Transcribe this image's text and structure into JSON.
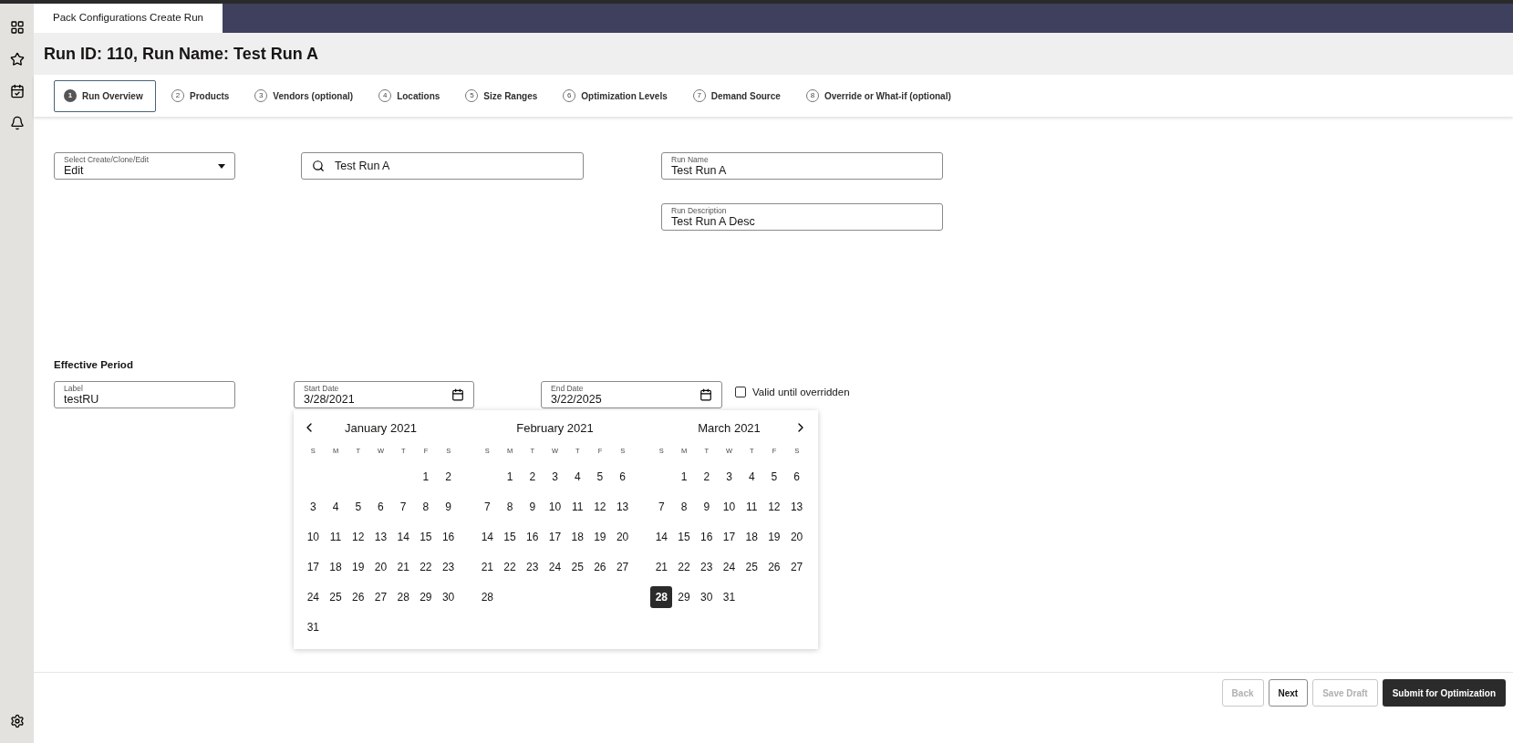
{
  "app_tab": {
    "label": "Pack Configurations Create Run"
  },
  "page_title": "Run ID: 110, Run Name: Test Run A",
  "steps": [
    {
      "number": "1",
      "label": "Run Overview",
      "selected": true
    },
    {
      "number": "2",
      "label": "Products",
      "selected": false
    },
    {
      "number": "3",
      "label": "Vendors (optional)",
      "selected": false
    },
    {
      "number": "4",
      "label": "Locations",
      "selected": false
    },
    {
      "number": "5",
      "label": "Size Ranges",
      "selected": false
    },
    {
      "number": "6",
      "label": "Optimization Levels",
      "selected": false
    },
    {
      "number": "7",
      "label": "Demand Source",
      "selected": false
    },
    {
      "number": "8",
      "label": "Override or What-if (optional)",
      "selected": false
    }
  ],
  "mode_select": {
    "label": "Select Create/Clone/Edit",
    "value": "Edit"
  },
  "search": {
    "value": "Test Run A"
  },
  "run_name": {
    "label": "Run Name",
    "value": "Test Run A"
  },
  "run_description": {
    "label": "Run Description",
    "value": "Test Run A Desc"
  },
  "effective_period": {
    "heading": "Effective Period",
    "label_field": {
      "label": "Label",
      "value": "testRU"
    },
    "start_date": {
      "label": "Start Date",
      "value": "3/28/2021"
    },
    "end_date": {
      "label": "End Date",
      "value": "3/22/2025"
    },
    "valid_until_overridden": {
      "label": "Valid until overridden",
      "checked": false
    }
  },
  "calendar": {
    "months": [
      {
        "title": "January 2021",
        "weekdays": [
          "S",
          "M",
          "T",
          "W",
          "T",
          "F",
          "S"
        ],
        "weeks": [
          {
            "kind": "leading",
            "days": [
              {
                "d": "1",
                "selected": false
              },
              {
                "d": "2",
                "selected": false
              }
            ]
          },
          {
            "kind": "full",
            "days": [
              {
                "d": "3",
                "selected": false
              },
              {
                "d": "4",
                "selected": false
              },
              {
                "d": "5",
                "selected": false
              },
              {
                "d": "6",
                "selected": false
              },
              {
                "d": "7",
                "selected": false
              },
              {
                "d": "8",
                "selected": false
              },
              {
                "d": "9",
                "selected": false
              }
            ]
          },
          {
            "kind": "full",
            "days": [
              {
                "d": "10",
                "selected": false
              },
              {
                "d": "11",
                "selected": false
              },
              {
                "d": "12",
                "selected": false
              },
              {
                "d": "13",
                "selected": false
              },
              {
                "d": "14",
                "selected": false
              },
              {
                "d": "15",
                "selected": false
              },
              {
                "d": "16",
                "selected": false
              }
            ]
          },
          {
            "kind": "full",
            "days": [
              {
                "d": "17",
                "selected": false
              },
              {
                "d": "18",
                "selected": false
              },
              {
                "d": "19",
                "selected": false
              },
              {
                "d": "20",
                "selected": false
              },
              {
                "d": "21",
                "selected": false
              },
              {
                "d": "22",
                "selected": false
              },
              {
                "d": "23",
                "selected": false
              }
            ]
          },
          {
            "kind": "full",
            "days": [
              {
                "d": "24",
                "selected": false
              },
              {
                "d": "25",
                "selected": false
              },
              {
                "d": "26",
                "selected": false
              },
              {
                "d": "27",
                "selected": false
              },
              {
                "d": "28",
                "selected": false
              },
              {
                "d": "29",
                "selected": false
              },
              {
                "d": "30",
                "selected": false
              }
            ]
          },
          {
            "kind": "trailing",
            "days": [
              {
                "d": "31",
                "selected": false
              }
            ]
          }
        ]
      },
      {
        "title": "February 2021",
        "weekdays": [
          "S",
          "M",
          "T",
          "W",
          "T",
          "F",
          "S"
        ],
        "weeks": [
          {
            "kind": "leading",
            "days": [
              {
                "d": "1",
                "selected": false
              },
              {
                "d": "2",
                "selected": false
              },
              {
                "d": "3",
                "selected": false
              },
              {
                "d": "4",
                "selected": false
              },
              {
                "d": "5",
                "selected": false
              },
              {
                "d": "6",
                "selected": false
              }
            ]
          },
          {
            "kind": "full",
            "days": [
              {
                "d": "7",
                "selected": false
              },
              {
                "d": "8",
                "selected": false
              },
              {
                "d": "9",
                "selected": false
              },
              {
                "d": "10",
                "selected": false
              },
              {
                "d": "11",
                "selected": false
              },
              {
                "d": "12",
                "selected": false
              },
              {
                "d": "13",
                "selected": false
              }
            ]
          },
          {
            "kind": "full",
            "days": [
              {
                "d": "14",
                "selected": false
              },
              {
                "d": "15",
                "selected": false
              },
              {
                "d": "16",
                "selected": false
              },
              {
                "d": "17",
                "selected": false
              },
              {
                "d": "18",
                "selected": false
              },
              {
                "d": "19",
                "selected": false
              },
              {
                "d": "20",
                "selected": false
              }
            ]
          },
          {
            "kind": "full",
            "days": [
              {
                "d": "21",
                "selected": false
              },
              {
                "d": "22",
                "selected": false
              },
              {
                "d": "23",
                "selected": false
              },
              {
                "d": "24",
                "selected": false
              },
              {
                "d": "25",
                "selected": false
              },
              {
                "d": "26",
                "selected": false
              },
              {
                "d": "27",
                "selected": false
              }
            ]
          },
          {
            "kind": "trailing",
            "days": [
              {
                "d": "28",
                "selected": false
              }
            ]
          }
        ]
      },
      {
        "title": "March 2021",
        "weekdays": [
          "S",
          "M",
          "T",
          "W",
          "T",
          "F",
          "S"
        ],
        "weeks": [
          {
            "kind": "leading",
            "days": [
              {
                "d": "1",
                "selected": false
              },
              {
                "d": "2",
                "selected": false
              },
              {
                "d": "3",
                "selected": false
              },
              {
                "d": "4",
                "selected": false
              },
              {
                "d": "5",
                "selected": false
              },
              {
                "d": "6",
                "selected": false
              }
            ]
          },
          {
            "kind": "full",
            "days": [
              {
                "d": "7",
                "selected": false
              },
              {
                "d": "8",
                "selected": false
              },
              {
                "d": "9",
                "selected": false
              },
              {
                "d": "10",
                "selected": false
              },
              {
                "d": "11",
                "selected": false
              },
              {
                "d": "12",
                "selected": false
              },
              {
                "d": "13",
                "selected": false
              }
            ]
          },
          {
            "kind": "full",
            "days": [
              {
                "d": "14",
                "selected": false
              },
              {
                "d": "15",
                "selected": false
              },
              {
                "d": "16",
                "selected": false
              },
              {
                "d": "17",
                "selected": false
              },
              {
                "d": "18",
                "selected": false
              },
              {
                "d": "19",
                "selected": false
              },
              {
                "d": "20",
                "selected": false
              }
            ]
          },
          {
            "kind": "full",
            "days": [
              {
                "d": "21",
                "selected": false
              },
              {
                "d": "22",
                "selected": false
              },
              {
                "d": "23",
                "selected": false
              },
              {
                "d": "24",
                "selected": false
              },
              {
                "d": "25",
                "selected": false
              },
              {
                "d": "26",
                "selected": false
              },
              {
                "d": "27",
                "selected": false
              }
            ]
          },
          {
            "kind": "trailing",
            "days": [
              {
                "d": "28",
                "selected": true
              },
              {
                "d": "29",
                "selected": false
              },
              {
                "d": "30",
                "selected": false
              },
              {
                "d": "31",
                "selected": false
              }
            ]
          }
        ]
      }
    ]
  },
  "buttons": [
    {
      "label": "Back",
      "kind": "secondary",
      "disabled": true
    },
    {
      "label": "Next",
      "kind": "secondary",
      "disabled": false
    },
    {
      "label": "Save Draft",
      "kind": "secondary",
      "disabled": true
    },
    {
      "label": "Submit for Optimization",
      "kind": "primary",
      "disabled": false
    }
  ]
}
